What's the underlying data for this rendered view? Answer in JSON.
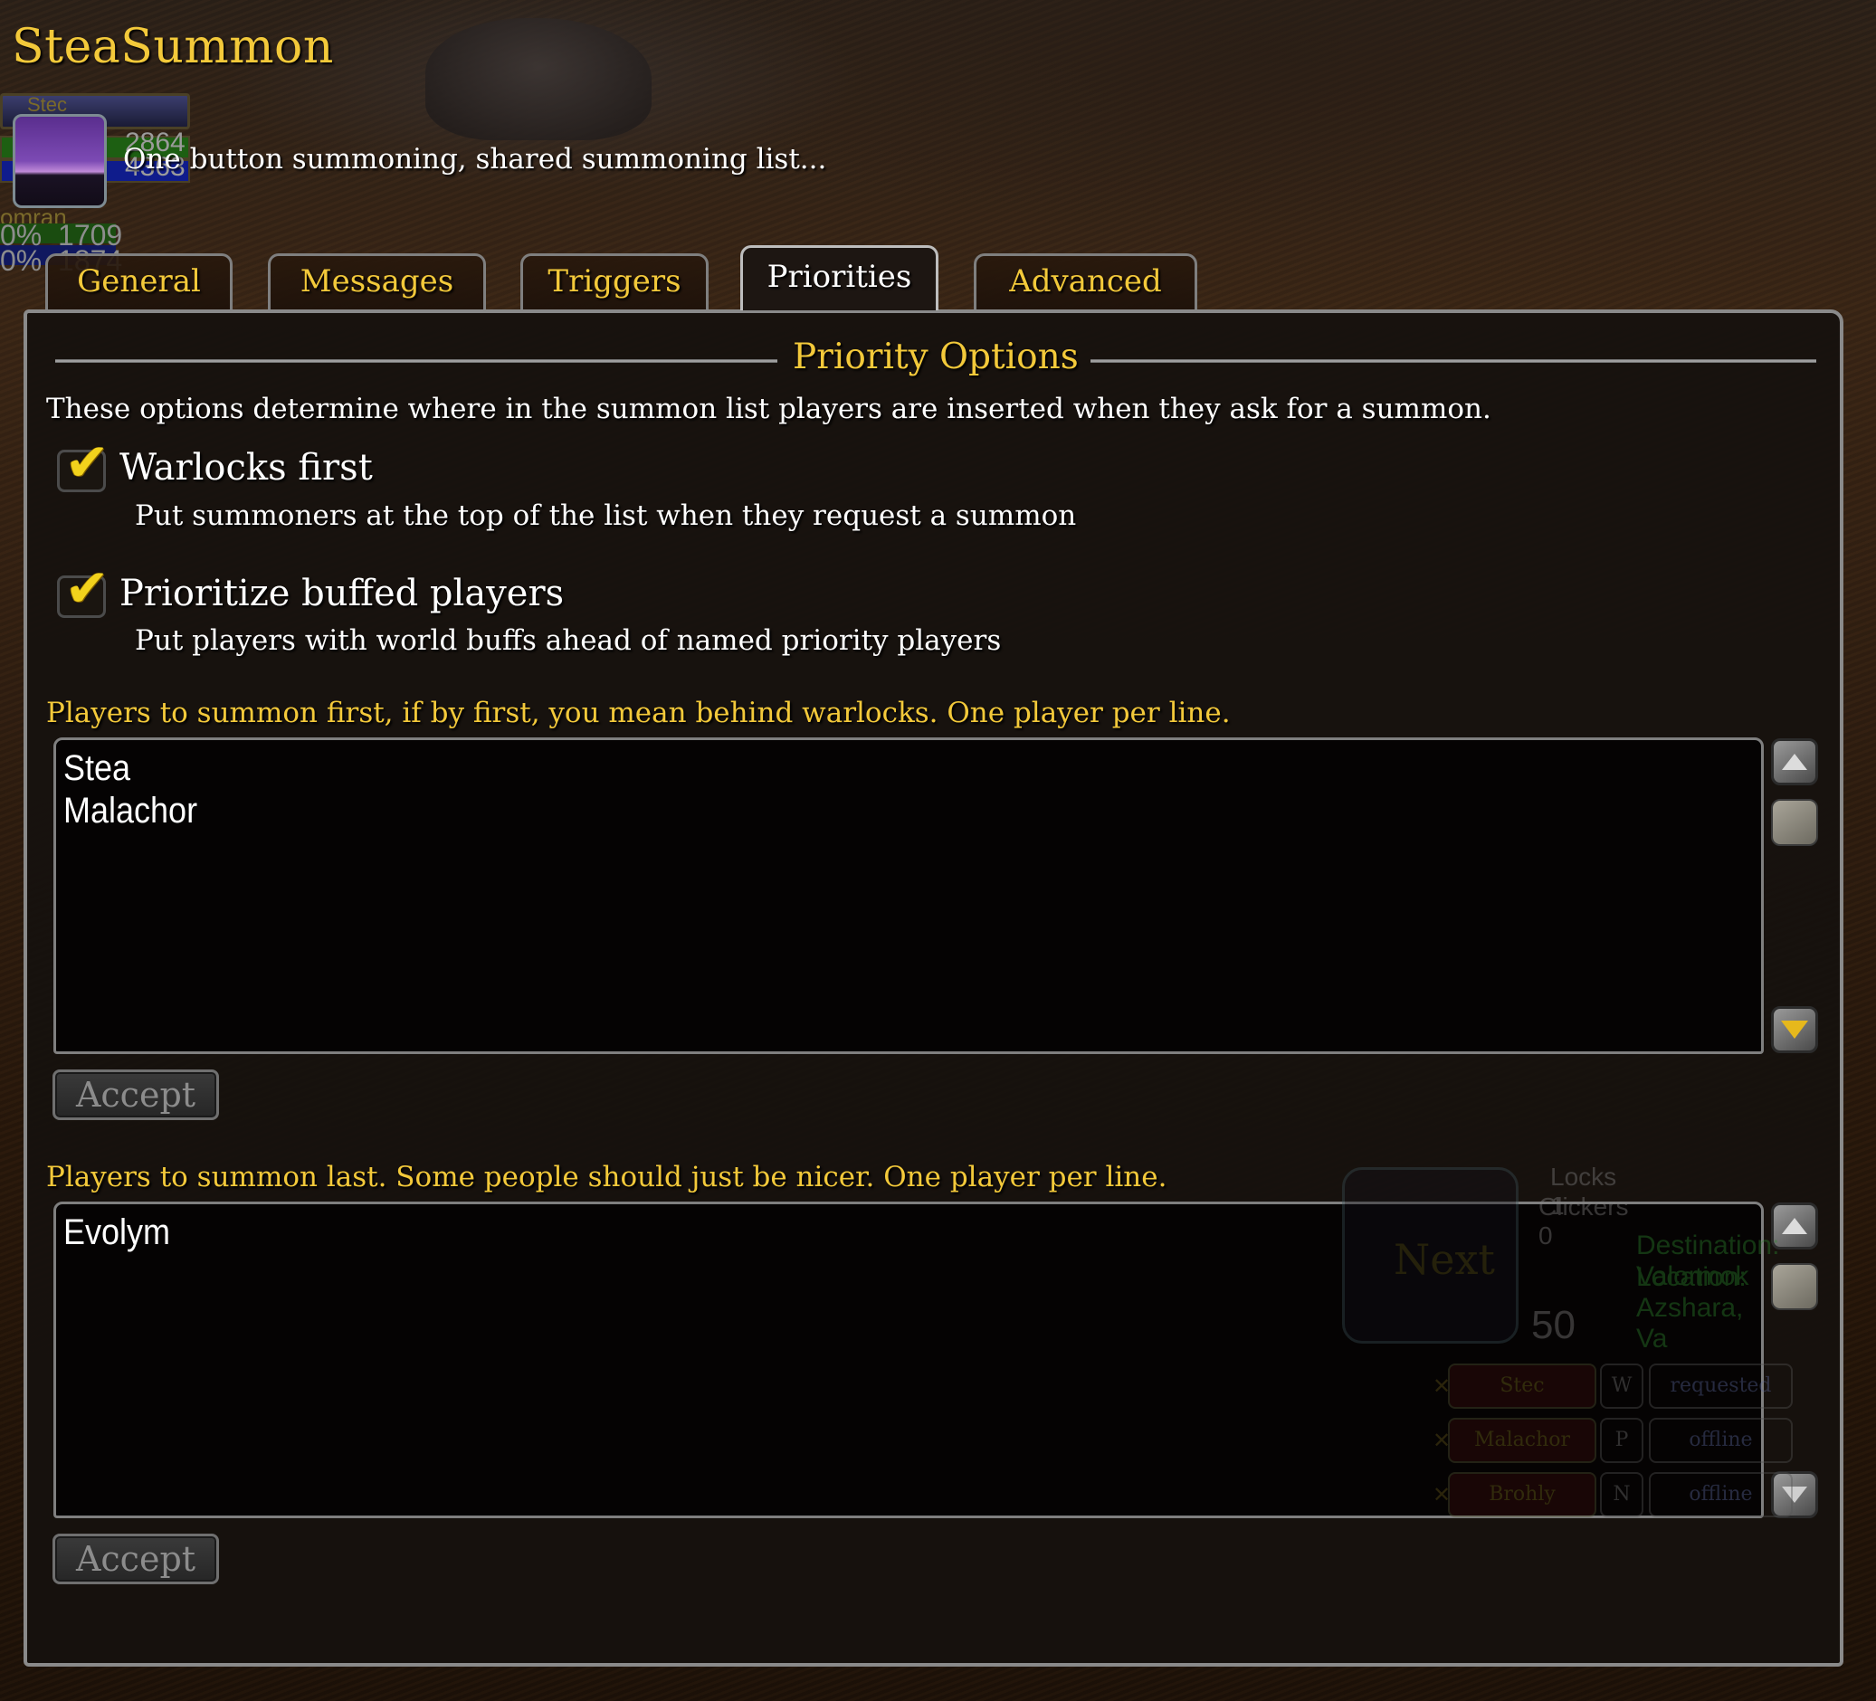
{
  "addon": {
    "title": "SteaSummon",
    "subtitle": "One button summoning, shared summoning list..."
  },
  "tabs": [
    {
      "label": "General",
      "selected": false
    },
    {
      "label": "Messages",
      "selected": false
    },
    {
      "label": "Triggers",
      "selected": false
    },
    {
      "label": "Priorities",
      "selected": true
    },
    {
      "label": "Advanced",
      "selected": false
    }
  ],
  "section": {
    "title": "Priority Options",
    "description": "These options determine where in the summon list players are inserted when they ask for a summon."
  },
  "options": [
    {
      "label": "Warlocks first",
      "description": "Put summoners at the top of the list when they request a summon",
      "checked": true
    },
    {
      "label": "Prioritize buffed players",
      "description": "Put players with world buffs ahead of named priority players",
      "checked": true
    }
  ],
  "first_list": {
    "label": "Players to summon first, if by first, you mean behind warlocks. One player per line.",
    "lines": [
      "Stea",
      "Malachor"
    ],
    "accept_label": "Accept"
  },
  "last_list": {
    "label": "Players to summon last. Some people should just be nicer. One player per line.",
    "lines": [
      "Evolym"
    ],
    "accept_label": "Accept"
  },
  "icons": {
    "checkmark": "✔"
  },
  "background_game_ui": {
    "unit1": {
      "name": "Stec",
      "health": "2864",
      "mana": "4363"
    },
    "unit2": {
      "name": "omran",
      "health_pct": "0%",
      "mana_pct": "0%",
      "health": "1709",
      "mana": "1874"
    },
    "summon_window": {
      "next_label": "Next",
      "locks": "Locks 1",
      "clickers": "Clickers 0",
      "destination": "Destination: Valormok",
      "location": "Location: Azshara, Va",
      "shards": "50",
      "rows": [
        {
          "name": "Stec",
          "tag": "W",
          "status": "requested"
        },
        {
          "name": "Malachor",
          "tag": "P",
          "status": "offline"
        },
        {
          "name": "Brohly",
          "tag": "N",
          "status": "offline"
        }
      ]
    }
  },
  "colors": {
    "gold": "#f3c93a",
    "white": "#ffffff",
    "disabled_text": "#8c8c8c"
  }
}
